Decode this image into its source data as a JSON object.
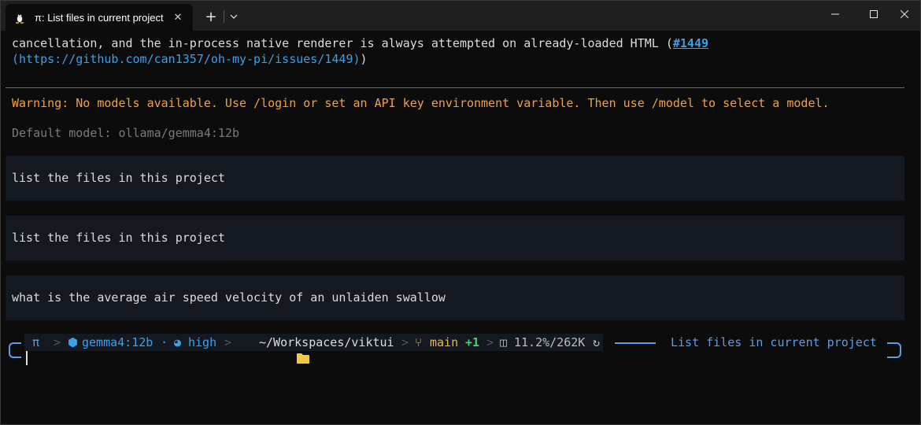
{
  "window": {
    "tab_title": "π: List files in current project",
    "tab_close": "✕",
    "new_tab": "+",
    "icons": {
      "tab": "linux-penguin-icon",
      "close": "close-icon",
      "dropdown": "chevron-down-icon",
      "minimize": "minimize-icon",
      "maximize": "maximize-icon",
      "window_close": "close-icon"
    }
  },
  "output": {
    "line1_text": "cancellation, and the in-process native renderer is always attempted on already-loaded HTML (",
    "line1_link": "#1449",
    "line2_text": "(https://github.com/can1357/oh-my-pi/issues/1449)",
    "line2_close": ")",
    "warning": "Warning: No models available. Use /login or set an API key environment variable. Then use /model to select a model.",
    "default_model": "Default model: ollama/gemma4:12b"
  },
  "messages": [
    "list the files in this project",
    "list the files in this project",
    "what is the average air speed velocity of an unlaiden swallow"
  ],
  "status": {
    "pi": "π",
    "sep": ">",
    "model_icon": "⬢",
    "model": "gemma4:12b",
    "dot": "·",
    "thinking_icon": "◕",
    "thinking": "high",
    "folder_icon": "folder-icon",
    "path": "~/Workspaces/viktui",
    "branch_icon": "⑂",
    "branch": "main",
    "changes": "+1",
    "ctx_icon": "◫",
    "context": "11.2%/262K",
    "refresh_icon": "↻",
    "session_title": "List files in current project"
  },
  "colors": {
    "accent": "#5e9de6",
    "warning": "#f0a044",
    "link": "#3aa0e8",
    "branch": "#e8b84a",
    "added": "#3fd66b"
  }
}
